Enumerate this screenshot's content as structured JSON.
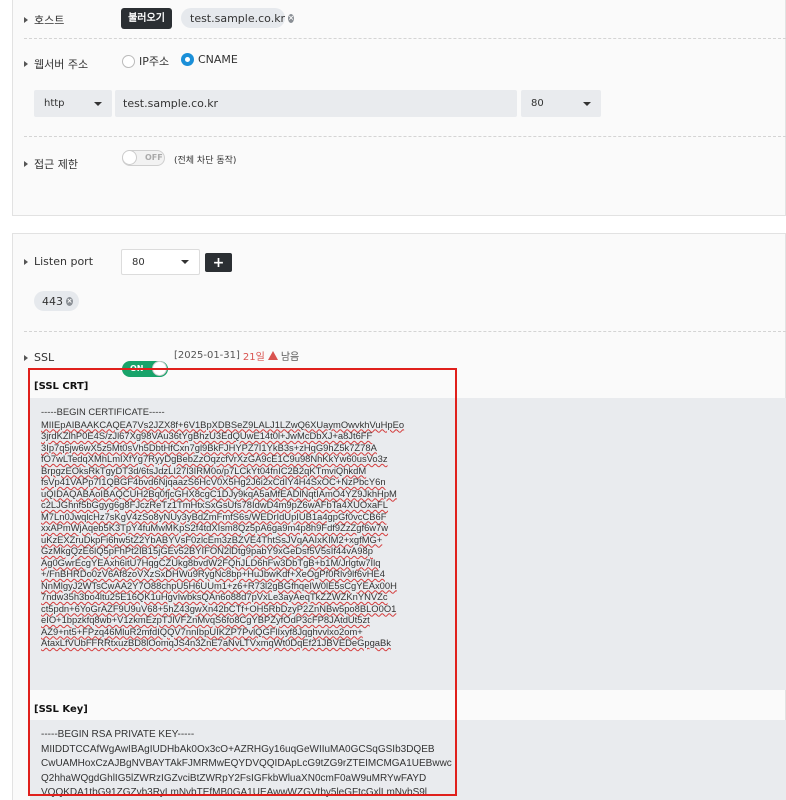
{
  "host": {
    "label": "호스트",
    "load_button": "불러오기",
    "chip": "test.sample.co.kr"
  },
  "web_server": {
    "label": "웹서버 주소",
    "radio_ip": "IP주소",
    "radio_cname": "CNAME",
    "selected": "CNAME",
    "protocol": "http",
    "host_value": "test.sample.co.kr",
    "port": "80"
  },
  "access": {
    "label": "접근 제한",
    "toggle": "OFF",
    "note": "(전체 차단 동작)"
  },
  "listen": {
    "label": "Listen port",
    "port": "80",
    "chip": "443"
  },
  "ssl": {
    "label": "SSL",
    "toggle": "ON",
    "date": "[2025-01-31]",
    "days": "21일",
    "remain": "남음",
    "crt_title": "[SSL CRT]",
    "key_title": "[SSL Key]",
    "crt_header": "-----BEGIN CERTIFICATE-----",
    "crt_lines": [
      "MIIEpAIBAAKCAQEA7Vs2JZX8f+6V1BpXDBSeZ9LALJ1LZwQ6XUaymOwvkhVuHpEo",
      "3jrdKZlhP0E4S/zJl67Xg98VAu36tYgBhzU3EdQUwE14t0l+JwMcDbXJ+a8Jt6FF",
      "3Ip7q5jw6wX5z5Mt0sVh5DbtHfCxn7gl9BkFJHYPZ7I1YkB3s+zHqG9hZ5k7Z78A",
      "fO7wLTedqXMhLmIXfYg7RyyDgBebZzOqzcfVrXzGA9cE1C9u98NhKkYw60usVo3z",
      "BrpgzEOksRkTgyDT3d/6tsJdzLI27l3IRM0o/p7LCkYt04fnIC2B2qKTmviQhkdM",
      "fsVp41VAPp7I1QBGF4bvd6NjqaazS6HcV0X5Hg2J6i2xCdIY4H4SxOC+NzPbcY6n",
      "uQIDAQABAoIBAQCUH2Bq0fjcGHX8cgC1DJy9kqA5aMfEADlNqtIAmO4YZ9JkhHpM",
      "c2LJGhnf5bGgyg6g8FJczReTz1TmHtxSxGsUfs78IdwD4m9pZ6wAFbTa4XUOxaFL",
      "M7Ln0JwqlcHz7sKgV4zSo8yNUy3yBdZmFmfS6s/WEDrIdUpIUB1a4gpGf0vcCB6F",
      "xxAPmWjAqeb5K3TpY4fuMwMKpS2f4tdXIsm8Qz5pA6ga9m4p8h9Fdf9ZzZgf6w7w",
      "uKzEXZruDkpFi6hw5tZ2YbABYVsF0zlcEm3zBZVE4ThtSsJVqAAIxKIM2+xgfMG+",
      "GzMkgQzE6lQ5pFhPt2IB15jGEv52BYIFON2lDtg9pabY9xGeDsf5V5sIf44vA98p",
      "Ag0GwrEcgYEAxh6itU7HqgCZUkg8bvdW2FQhJLD6hFw3DbTgB+b1M/Jrlgtw7Ilq",
      "+/FnBHRDo0zV6Af8zoVXzSxDHWu9RygNc8bp+HuJbwKdf+XeOgPf0Rlv9lf6vHE4",
      "NnMlgyJ2WTsCwAA2Y7O88chpU5H6UUm1+z6+R73l2gBGfhqeIW0lE5sCgYEAx00H",
      "7ndw35h3bo4ltu25E16QK1uHgvIwbksQAn6o88d7pVxLe3ayAeqTkZZWZKnYNVZc",
      "ct5pdn+6YoGrAZF9U9uV68+5hZ43gwXn42bCTf+OH5RbDzyP2ZnNBw5po8BLO0O1",
      "eIO+1bpzkfq8wb+V1zkmEzpTJlVFZnMvqS6fo8CgYBPZyfOdP3cFP8JAtdUt5zt",
      "AZ9+nt5+FPzq46MluR2mfdIQQV7nnIbpUIKZP7PvlQGFlIxyf8Jqghvvlxo2om+",
      "AtaxLfVUbFFRRtxuzBD8lOomqJS4n3ZnE7aNvLTVxmqWt0DqEf21JBVEDeGpgaBk"
    ],
    "key_header": "-----BEGIN RSA PRIVATE KEY-----",
    "key_lines": [
      "MIIDDTCCAfWgAwIBAgIUDHbAk0Ox3cO+AZRHGy16uqGeWIIuMA0GCSqGSIb3DQEB",
      "CwUAMHoxCzAJBgNVBAYTAkFJMRMwEQYDVQQIDApLcG9tZG9rZTEIMCMGA1UEBwwc",
      "Q2hhaWQgdGhlIG5lZWRzIGZvciBtZWRpY2FsIGFkbWluaXN0cmF0aW9uMRYwFAYD",
      "VQQKDA1tbG91ZGZvb3RyLmNvbTEfMB0GA1UEAwwWZGVtby5leGFtcGxlLmNvbS9l"
    ]
  }
}
